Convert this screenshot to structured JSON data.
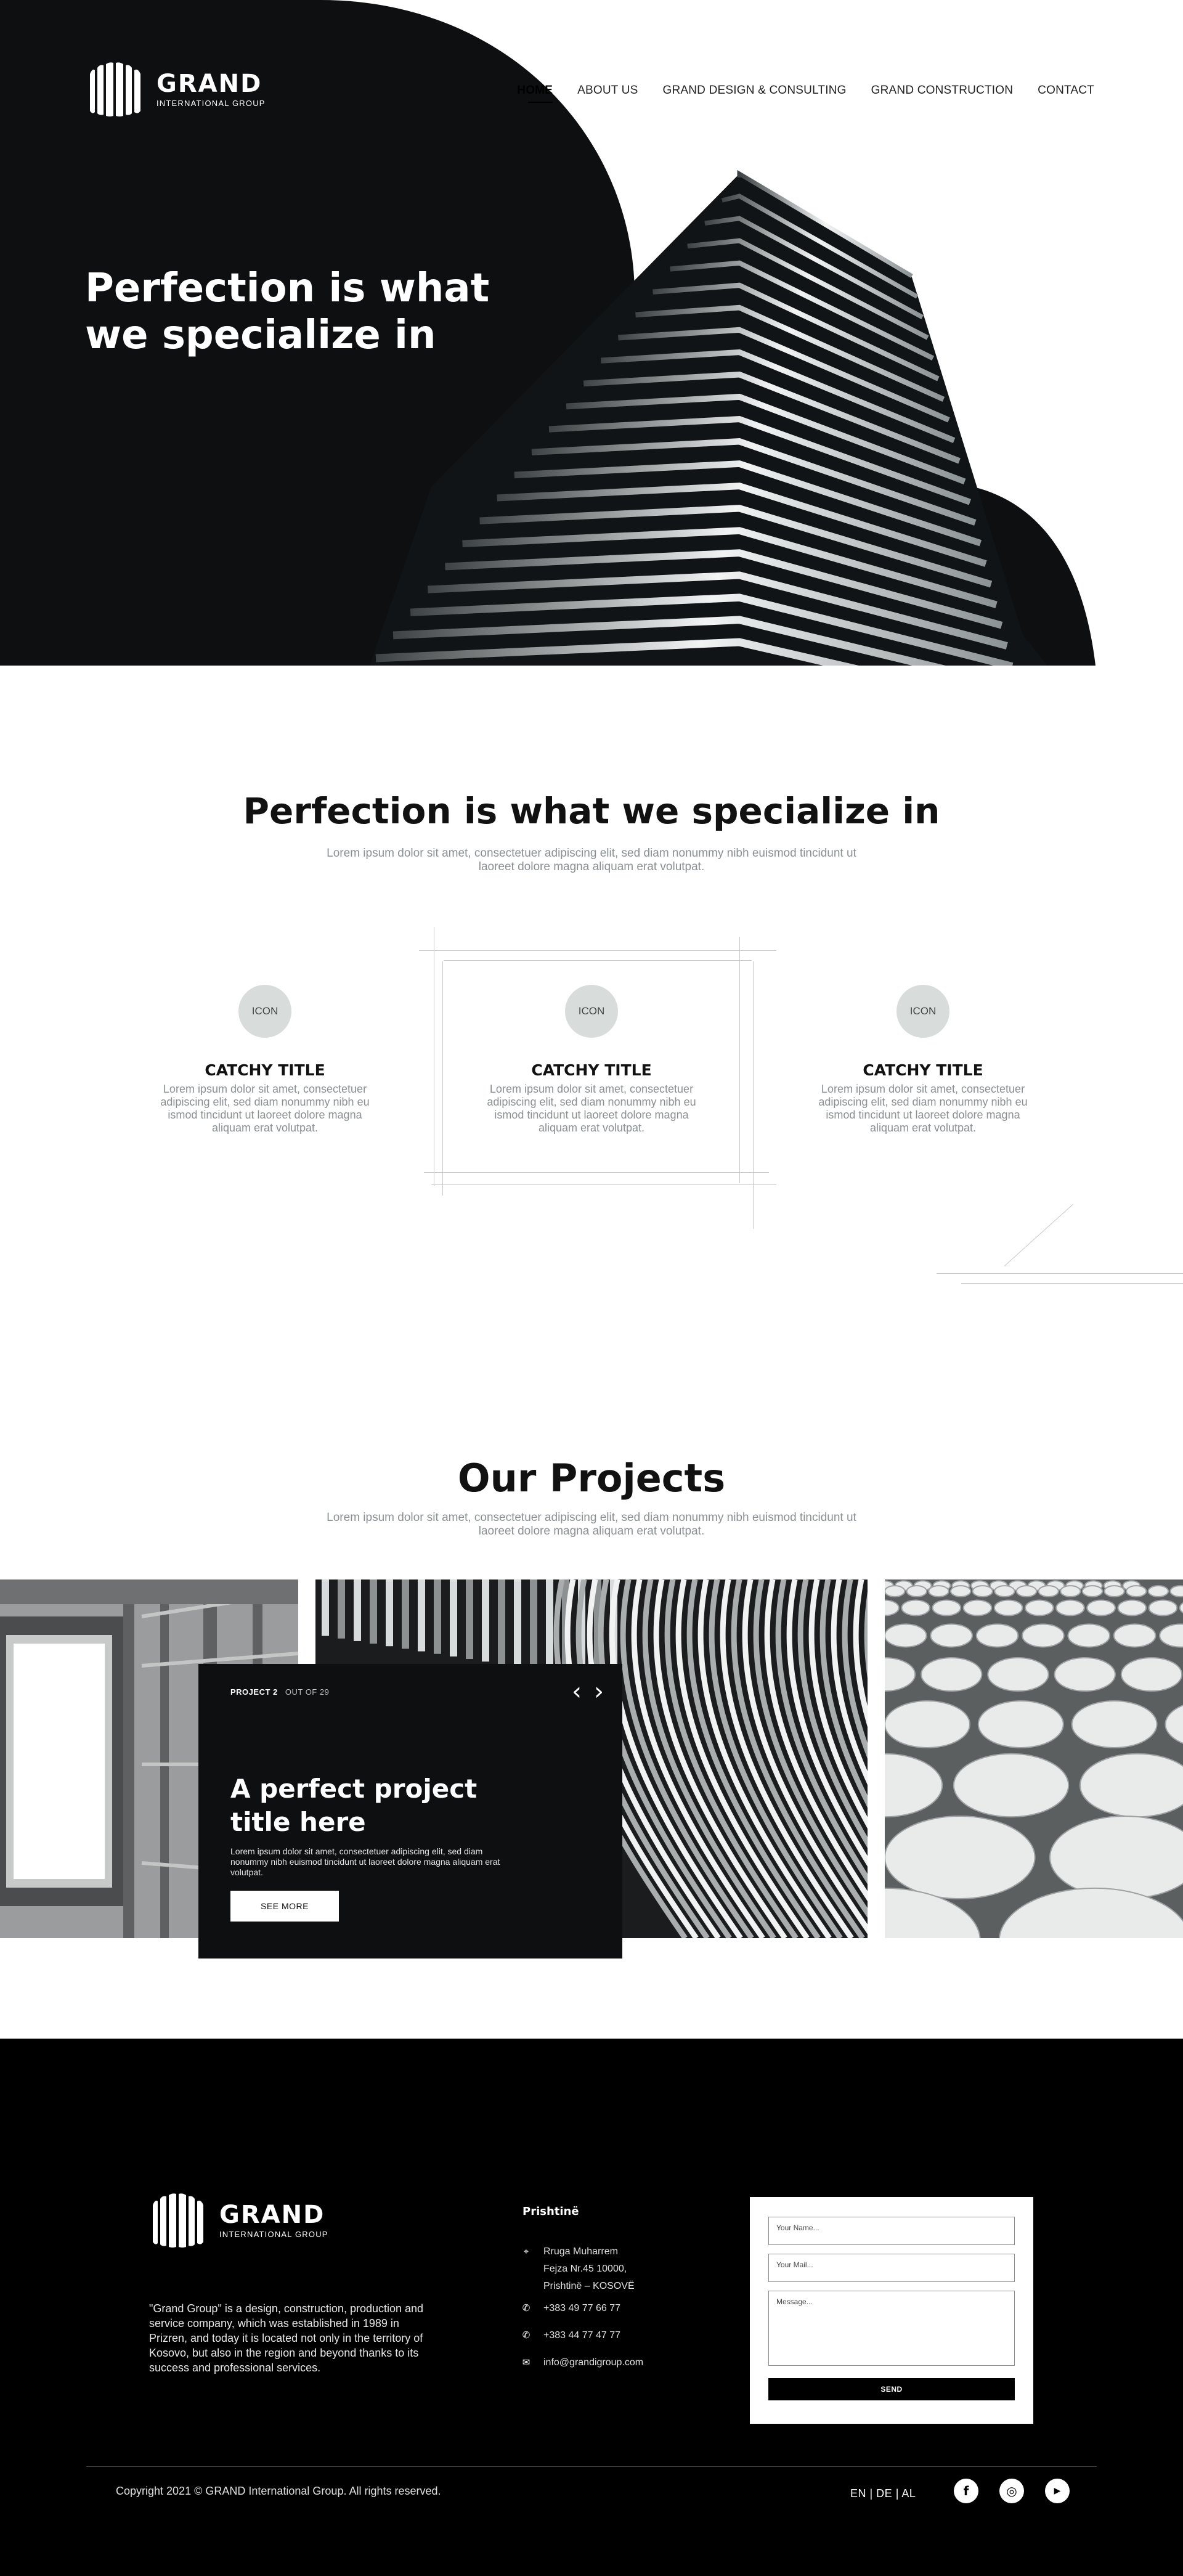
{
  "brand": {
    "name": "GRAND",
    "sub": "INTERNATIONAL GROUP"
  },
  "nav": {
    "items": [
      {
        "label": "HOME",
        "active": true
      },
      {
        "label": "ABOUT US",
        "active": false
      },
      {
        "label": "GRAND DESIGN & CONSULTING",
        "active": false
      },
      {
        "label": "GRAND CONSTRUCTION",
        "active": false
      },
      {
        "label": "CONTACT",
        "active": false
      }
    ]
  },
  "hero": {
    "title": "Perfection is what we specialize in"
  },
  "specialize": {
    "title": "Perfection is what we specialize in",
    "subtitle": "Lorem ipsum dolor sit amet, consectetuer adipiscing elit, sed diam nonummy nibh euismod tincidunt ut laoreet dolore magna aliquam erat volutpat.",
    "features": [
      {
        "icon": "ICON",
        "title": "CATCHY TITLE",
        "text": "Lorem ipsum dolor sit amet, consectetuer adipiscing elit, sed diam nonummy nibh eu ismod tincidunt ut laoreet dolore magna aliquam erat volutpat."
      },
      {
        "icon": "ICON",
        "title": "CATCHY TITLE",
        "text": "Lorem ipsum dolor sit amet, consectetuer adipiscing elit, sed diam nonummy nibh eu ismod tincidunt ut laoreet dolore magna aliquam erat volutpat."
      },
      {
        "icon": "ICON",
        "title": "CATCHY TITLE",
        "text": "Lorem ipsum dolor sit amet, consectetuer adipiscing elit, sed diam nonummy nibh eu ismod tincidunt ut laoreet dolore magna aliquam erat volutpat."
      }
    ]
  },
  "projects": {
    "title": "Our Projects",
    "subtitle": "Lorem ipsum dolor sit amet, consectetuer adipiscing elit, sed diam nonummy nibh euismod tincidunt ut laoreet dolore magna aliquam erat volutpat.",
    "card": {
      "counter": "PROJECT 2",
      "total": "OUT OF 29",
      "title": "A perfect project title here",
      "desc": "Lorem ipsum dolor sit amet, consectetuer adipiscing elit, sed diam nonummy nibh euismod tincidunt ut laoreet dolore magna aliquam erat volutpat.",
      "button": "SEE MORE",
      "prev": "‹",
      "next": "›"
    }
  },
  "footer": {
    "about": "\"Grand Group\" is a design, construction, production and service company, which was established in 1989 in Prizren, and today it is located not only in the territory of Kosovo, but also in the region and beyond thanks to its success and professional services.",
    "city": "Prishtinë",
    "address": [
      "Rruga Muharrem",
      "Fejza Nr.45 10000,",
      "Prishtinë – KOSOVË"
    ],
    "phone1": "+383 49 77 66 77",
    "phone2": "+383 44 77 47 77",
    "email": "info@grandigroup.com",
    "form": {
      "name_placeholder": "Your Name...",
      "mail_placeholder": "Your Mail...",
      "message_placeholder": "Message...",
      "send": "SEND"
    },
    "copyright": "Copyright 2021 © GRAND International Group. All rights reserved.",
    "languages": "EN | DE | AL",
    "social": [
      {
        "icon": "facebook-icon",
        "glyph": "f"
      },
      {
        "icon": "instagram-icon",
        "glyph": "◎"
      },
      {
        "icon": "youtube-icon",
        "glyph": "▶"
      }
    ]
  },
  "colors": {
    "dark": "#0d0f10",
    "accent_gray": "#d8dcdb",
    "muted_text": "#8a8f92",
    "white": "#ffffff"
  }
}
